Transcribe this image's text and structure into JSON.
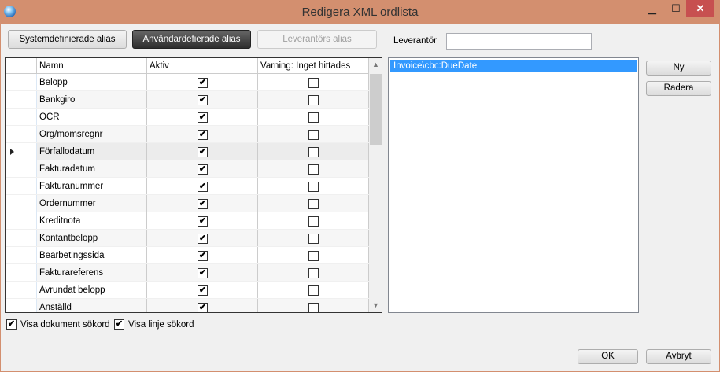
{
  "window": {
    "title": "Redigera XML ordlista",
    "min": "▁",
    "max": "☐",
    "close": "✕"
  },
  "tabs": {
    "system": "Systemdefinierade alias",
    "user": "Användardefierade alias",
    "supplier": "Leverantörs alias"
  },
  "supplier": {
    "label": "Leverantör",
    "value": ""
  },
  "grid": {
    "headers": [
      "Namn",
      "Aktiv",
      "Varning: Inget hittades"
    ],
    "rows": [
      {
        "name": "Belopp",
        "active": true,
        "warn": false
      },
      {
        "name": "Bankgiro",
        "active": true,
        "warn": false
      },
      {
        "name": "OCR",
        "active": true,
        "warn": false
      },
      {
        "name": "Org/momsregnr",
        "active": true,
        "warn": false
      },
      {
        "name": "Förfallodatum",
        "active": true,
        "warn": false,
        "current": true
      },
      {
        "name": "Fakturadatum",
        "active": true,
        "warn": false
      },
      {
        "name": "Fakturanummer",
        "active": true,
        "warn": false
      },
      {
        "name": "Ordernummer",
        "active": true,
        "warn": false
      },
      {
        "name": "Kreditnota",
        "active": true,
        "warn": false
      },
      {
        "name": "Kontantbelopp",
        "active": true,
        "warn": false
      },
      {
        "name": "Bearbetingssida",
        "active": true,
        "warn": false
      },
      {
        "name": "Fakturareferens",
        "active": true,
        "warn": false
      },
      {
        "name": "Avrundat belopp",
        "active": true,
        "warn": false
      },
      {
        "name": "Anställd",
        "active": true,
        "warn": false
      }
    ]
  },
  "aliases": [
    "Invoice\\cbc:DueDate"
  ],
  "buttons": {
    "new": "Ny",
    "delete": "Radera",
    "ok": "OK",
    "cancel": "Avbryt"
  },
  "options": {
    "doc": "Visa dokument sökord",
    "line": "Visa linje sökord"
  },
  "check": "✔"
}
